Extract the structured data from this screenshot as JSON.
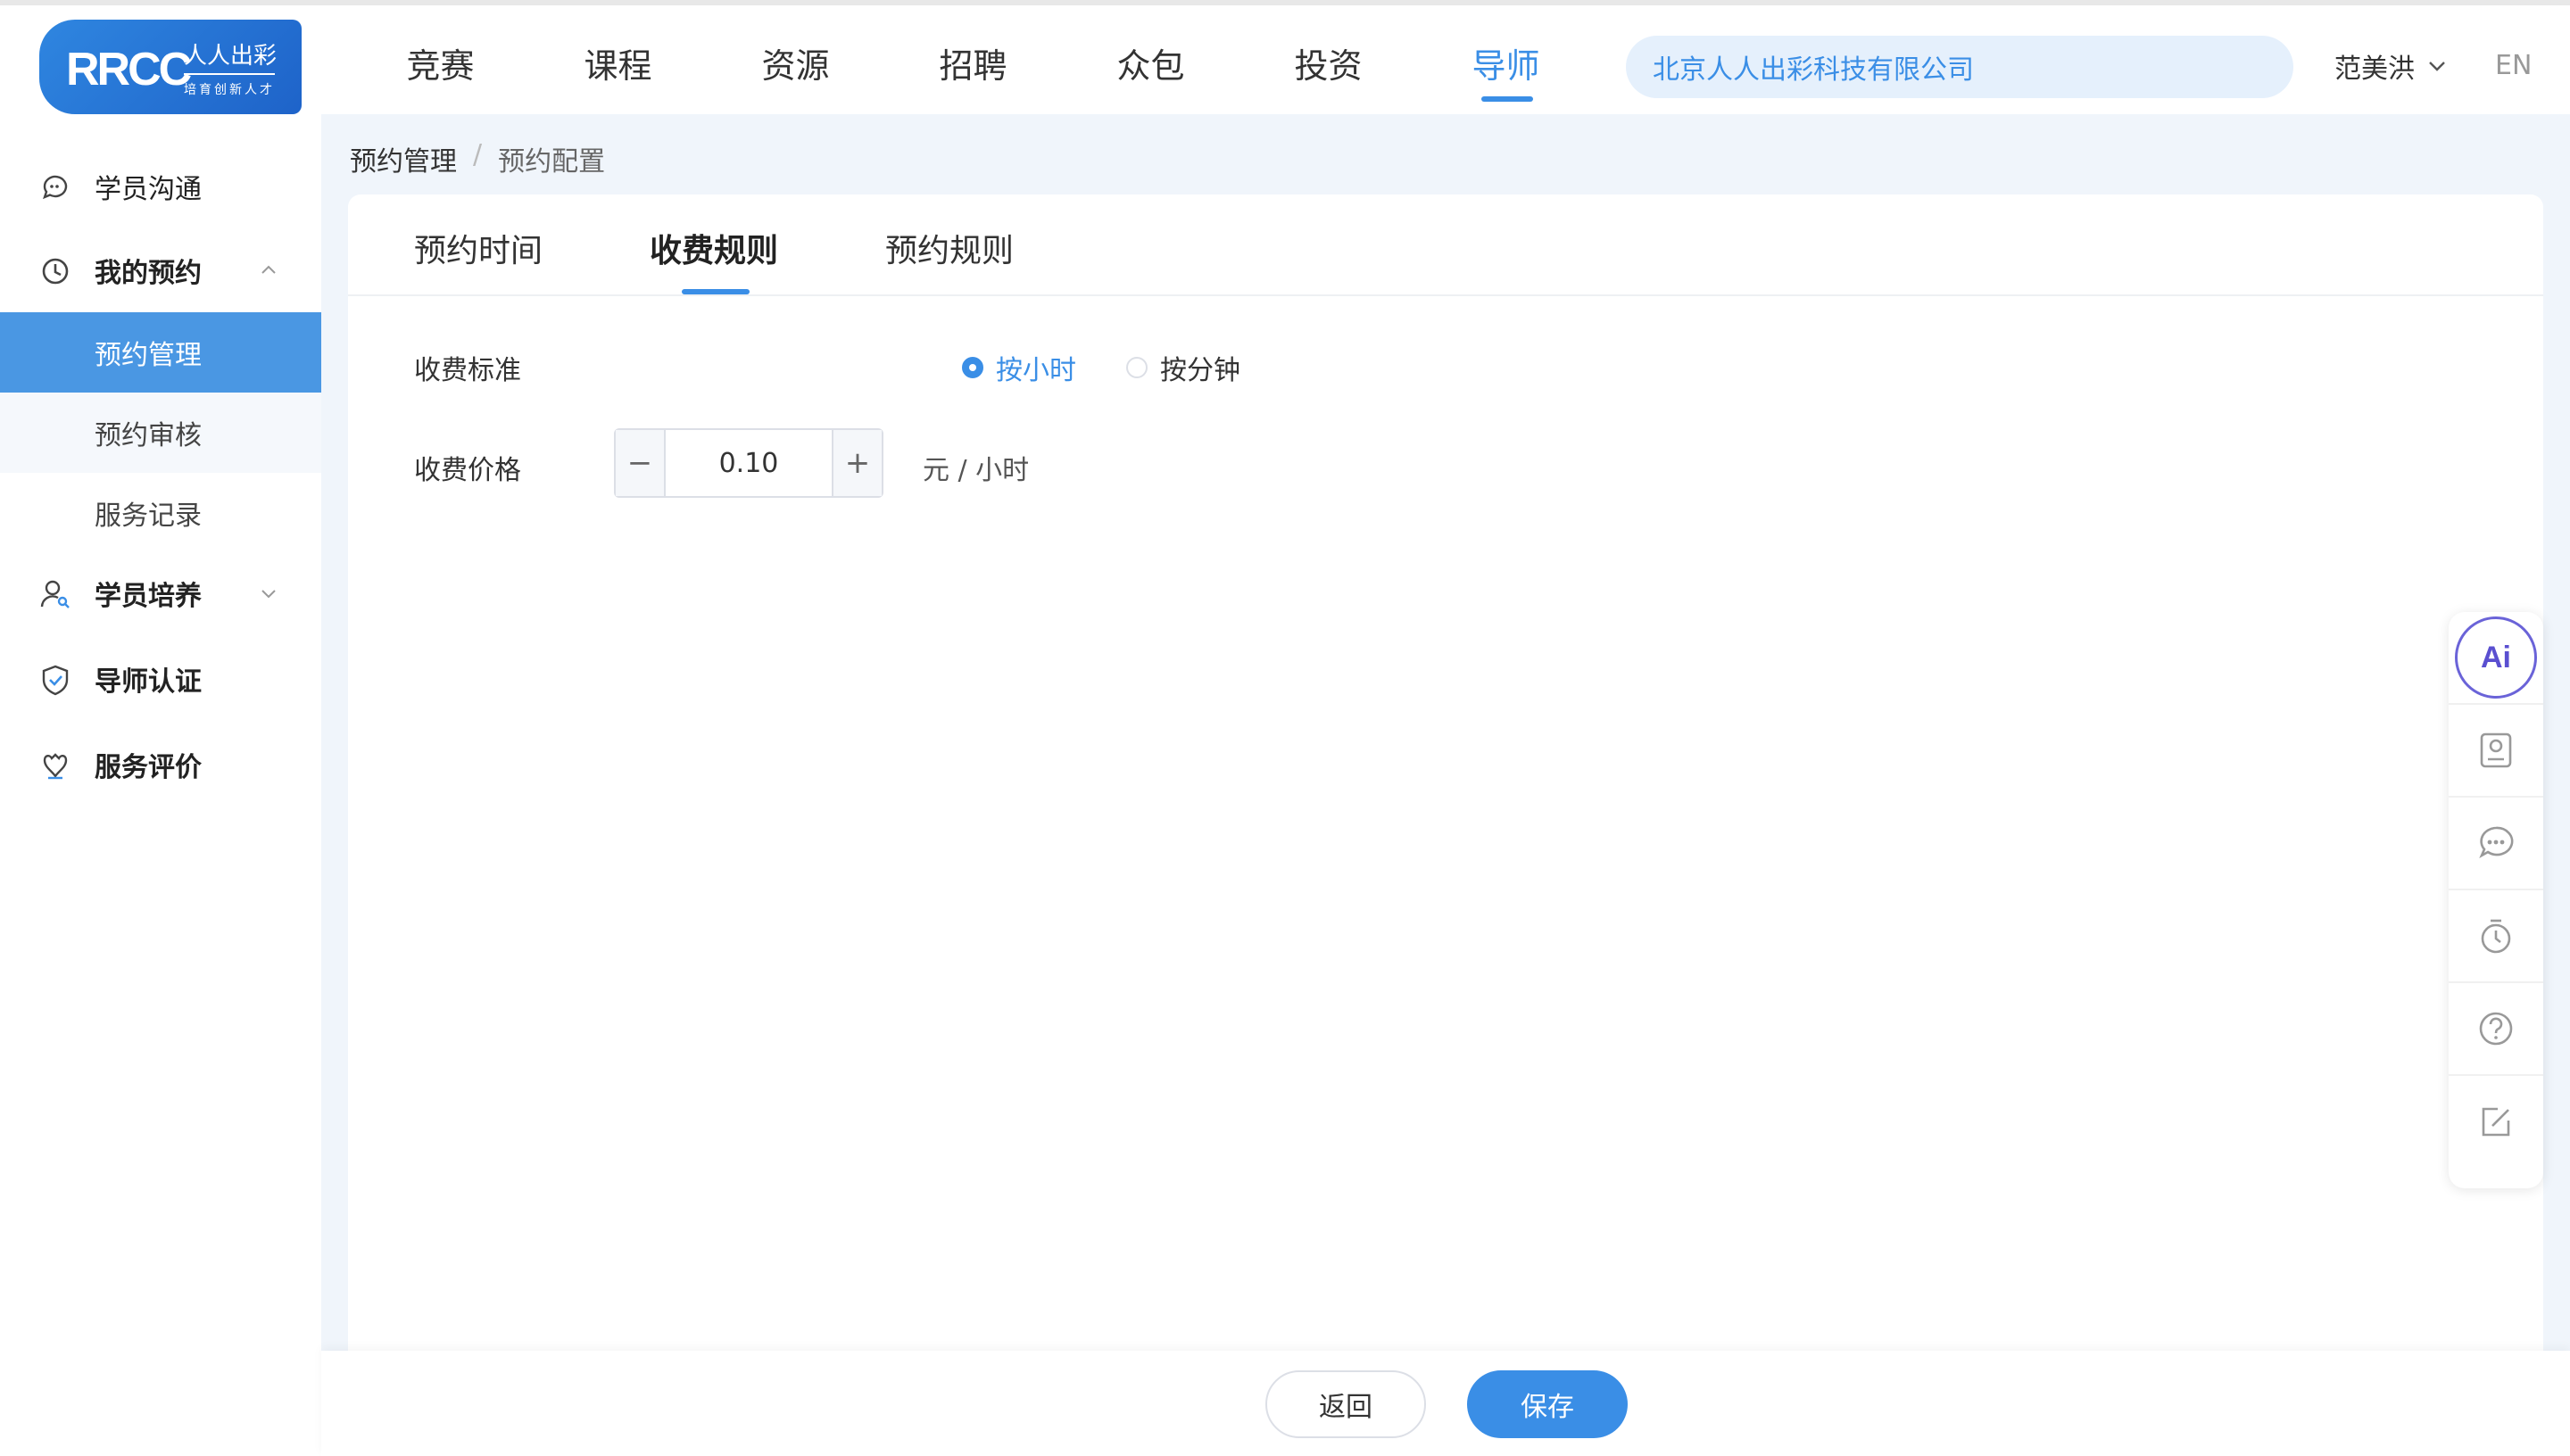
{
  "brand": {
    "logo_mark": "RRCC",
    "logo_cn": "人人出彩",
    "logo_sub": "培育创新人才"
  },
  "nav": {
    "items": [
      {
        "label": "竞赛"
      },
      {
        "label": "课程"
      },
      {
        "label": "资源"
      },
      {
        "label": "招聘"
      },
      {
        "label": "众包"
      },
      {
        "label": "投资"
      },
      {
        "label": "导师"
      }
    ],
    "active": "导师"
  },
  "company": "北京人人出彩科技有限公司",
  "user": {
    "name": "范美洪"
  },
  "lang": "EN",
  "sidebar": {
    "items": [
      {
        "label": "学员沟通",
        "icon": "chat-bubble-icon"
      },
      {
        "label": "我的预约",
        "icon": "clock-icon"
      },
      {
        "label": "预约管理"
      },
      {
        "label": "预约审核"
      },
      {
        "label": "服务记录"
      },
      {
        "label": "学员培养",
        "icon": "person-search-icon"
      },
      {
        "label": "导师认证",
        "icon": "shield-check-icon"
      },
      {
        "label": "服务评价",
        "icon": "rating-icon"
      }
    ]
  },
  "breadcrumb": {
    "parent": "预约管理",
    "separator": "/",
    "current": "预约配置"
  },
  "tabs": [
    {
      "label": "预约时间"
    },
    {
      "label": "收费规则"
    },
    {
      "label": "预约规则"
    }
  ],
  "active_tab": "收费规则",
  "form": {
    "standard_label": "收费标准",
    "options": [
      {
        "label": "按小时",
        "checked": true
      },
      {
        "label": "按分钟",
        "checked": false
      }
    ],
    "price_label": "收费价格",
    "price_value": "0.10",
    "minus": "−",
    "plus": "+",
    "unit": "元 / 小时"
  },
  "footer": {
    "back": "返回",
    "save": "保存"
  },
  "float_bar": {
    "ai_label": "Ai"
  },
  "colors": {
    "primary": "#3a8ee6",
    "active_bg": "#4a97e3",
    "page_bg": "#f0f5fb",
    "pill_bg": "#e5f0fc"
  }
}
